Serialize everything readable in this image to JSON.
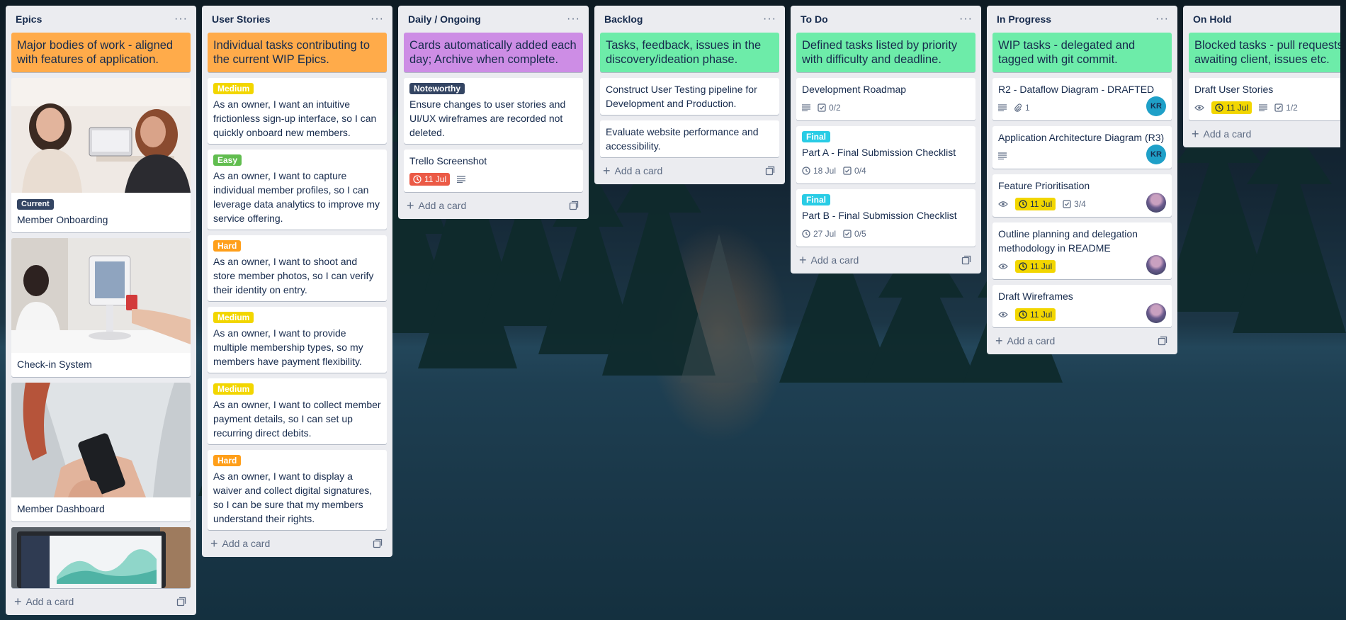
{
  "lists": [
    {
      "title": "Epics",
      "desc": "Major bodies of work - aligned with features of application.",
      "desc_color": "#ffab4a",
      "cards": [
        {
          "label": "Current",
          "label_color": "#344563",
          "title": "Member Onboarding",
          "cover": "two-people-laptop"
        },
        {
          "title": "Check-in System",
          "cover": "tablet-kiosk"
        },
        {
          "title": "Member Dashboard",
          "cover": "phone-in-hand"
        },
        {
          "cover": "laptop-dashboard"
        }
      ],
      "add": "Add a card"
    },
    {
      "title": "User Stories",
      "desc": "Individual tasks contributing to the current WIP Epics.",
      "desc_color": "#ffab4a",
      "cards": [
        {
          "label": "Medium",
          "label_color": "#f2d600",
          "text": "As an owner, I want an intuitive frictionless sign-up interface, so I can quickly onboard new members."
        },
        {
          "label": "Easy",
          "label_color": "#61bd4f",
          "text": "As an owner, I want to capture individual member profiles, so I can leverage data analytics to improve my service offering."
        },
        {
          "label": "Hard",
          "label_color": "#ff9f1a",
          "text": "As an owner, I want to shoot and store member photos, so I can verify their identity on entry."
        },
        {
          "label": "Medium",
          "label_color": "#f2d600",
          "text": "As an owner, I want to provide multiple membership types, so my members have payment flexibility."
        },
        {
          "label": "Medium",
          "label_color": "#f2d600",
          "text": "As an owner, I want to collect member payment details, so I can set up recurring direct debits."
        },
        {
          "label": "Hard",
          "label_color": "#ff9f1a",
          "text": "As an owner, I want to display a waiver and collect digital signatures, so I can be sure that my members understand their rights."
        }
      ],
      "add": "Add a card"
    },
    {
      "title": "Daily / Ongoing",
      "desc": "Cards automatically added each day; Archive when complete.",
      "desc_color": "#cd8de5",
      "cards": [
        {
          "label": "Noteworthy",
          "label_color": "#344563",
          "text": "Ensure changes to user stories and UI/UX wireframes are recorded not deleted."
        },
        {
          "text": "Trello Screenshot",
          "due": "11 Jul",
          "due_style": "red",
          "has_desc": true
        }
      ],
      "add": "Add a card"
    },
    {
      "title": "Backlog",
      "desc": "Tasks, feedback, issues in the discovery/ideation phase.",
      "desc_color": "#6deca9",
      "cards": [
        {
          "text": "Construct User Testing pipeline for Development and Production."
        },
        {
          "text": "Evaluate website performance and accessibility."
        }
      ],
      "add": "Add a card"
    },
    {
      "title": "To Do",
      "desc": "Defined tasks listed by priority with difficulty and deadline.",
      "desc_color": "#6deca9",
      "cards": [
        {
          "text": "Development Roadmap",
          "has_desc": true,
          "checklist": "0/2"
        },
        {
          "label": "Final",
          "label_color": "#29cce5",
          "text": "Part A - Final Submission Checklist",
          "date": "18 Jul",
          "checklist": "0/4"
        },
        {
          "label": "Final",
          "label_color": "#29cce5",
          "text": "Part B - Final Submission Checklist",
          "date": "27 Jul",
          "checklist": "0/5"
        }
      ],
      "add": "Add a card"
    },
    {
      "title": "In Progress",
      "desc": "WIP tasks - delegated and tagged with git commit.",
      "desc_color": "#6deca9",
      "cards": [
        {
          "text": "R2 - Dataflow Diagram - DRAFTED",
          "has_desc": true,
          "attach": "1",
          "avatar": "KR"
        },
        {
          "text": "Application Architecture Diagram (R3)",
          "has_desc": true,
          "avatar": "KR"
        },
        {
          "text": "Feature Prioritisation",
          "watch": true,
          "due": "11 Jul",
          "due_style": "yellow",
          "checklist": "3/4",
          "avatar_photo": true
        },
        {
          "text": "Outline planning and delegation methodology in README",
          "watch": true,
          "due": "11 Jul",
          "due_style": "yellow",
          "avatar_photo": true
        },
        {
          "text": "Draft Wireframes",
          "watch": true,
          "due": "11 Jul",
          "due_style": "yellow",
          "avatar_photo": true
        }
      ],
      "add": "Add a card"
    },
    {
      "title": "On Hold",
      "desc": "Blocked tasks - pull requests awaiting client, issues etc.",
      "desc_color": "#6deca9",
      "cards": [
        {
          "text": "Draft User Stories",
          "watch": true,
          "due": "11 Jul",
          "due_style": "yellow",
          "has_desc": true,
          "checklist": "1/2"
        }
      ],
      "add": "Add a card"
    }
  ]
}
